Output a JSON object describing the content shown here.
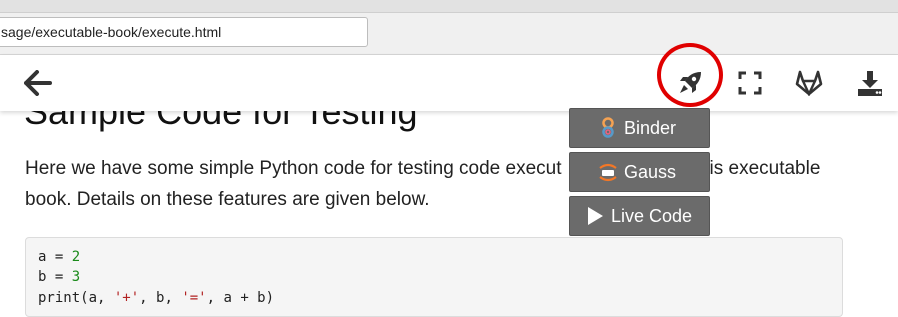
{
  "browser": {
    "url": "sage/executable-book/execute.html"
  },
  "page": {
    "heading": "Sample Code for Testing",
    "paragraph_before": "Here we have some simple Python code for testing code execut",
    "paragraph_after": "is executable book. Details on these features are given below.",
    "code": {
      "line1": {
        "var": "a",
        "op": " = ",
        "value": "2"
      },
      "line2": {
        "var": "b",
        "op": " = ",
        "value": "3"
      },
      "line3_start": "print(a, ",
      "line3_str1": "'+'",
      "line3_mid": ", b, ",
      "line3_str2": "'='",
      "line3_end": ", a + b)"
    }
  },
  "toolbar": {
    "icons": [
      "arrow-left-icon",
      "rocket-icon",
      "fullscreen-icon",
      "gitlab-icon",
      "download-icon"
    ]
  },
  "launch_menu": {
    "items": [
      {
        "label": "Binder",
        "icon": "binder-icon"
      },
      {
        "label": "Gauss",
        "icon": "jupyterhub-icon"
      },
      {
        "label": "Live Code",
        "icon": "play-icon"
      }
    ]
  },
  "colors": {
    "highlight": "#e00000",
    "menu_bg": "#6b6b6b",
    "code_number": "#1a8a1a",
    "code_string": "#b22222"
  }
}
